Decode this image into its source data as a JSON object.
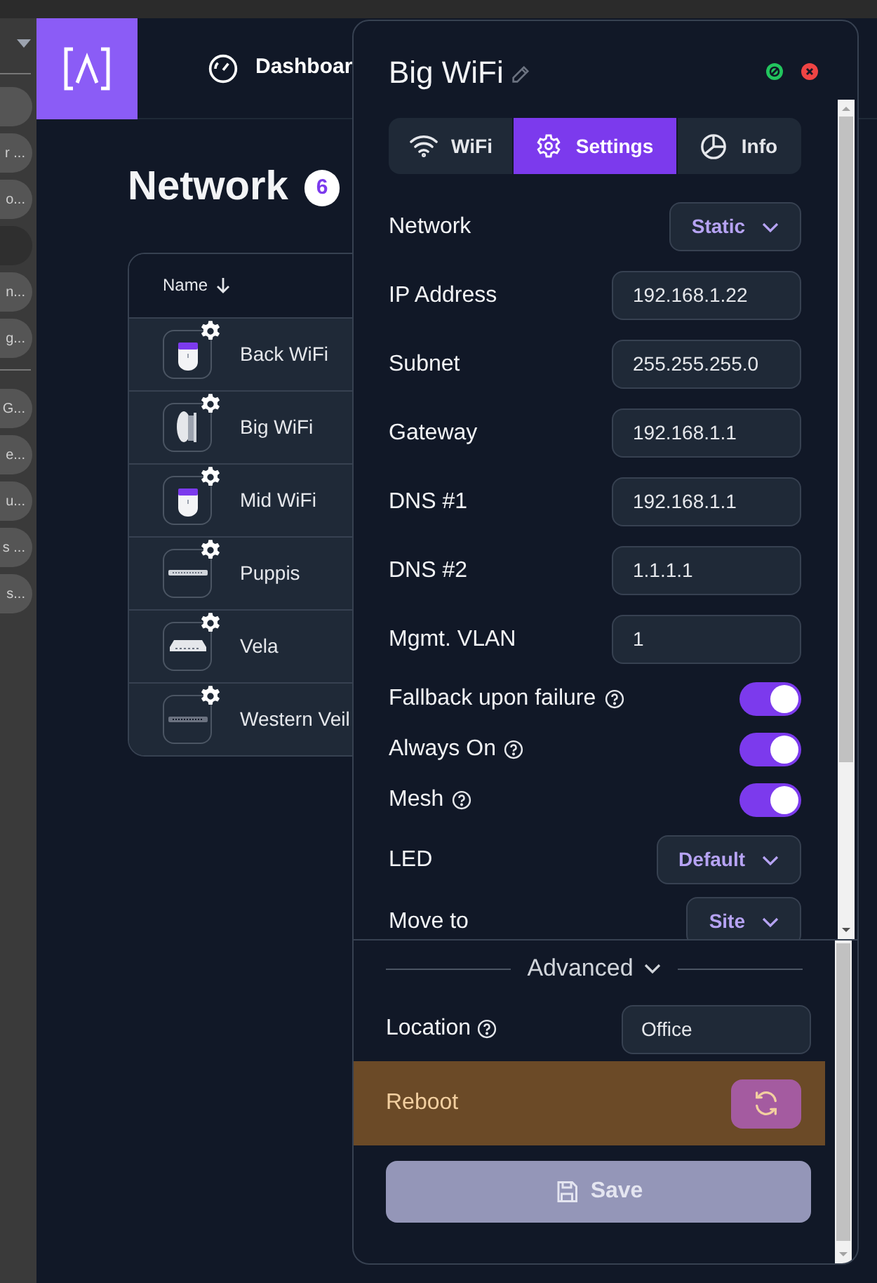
{
  "sidebar": {
    "groups": [
      [
        {
          "selected": false
        },
        {
          "label": "r ...",
          "selected": false
        },
        {
          "label": "o...",
          "selected": false
        },
        {
          "selected": true
        },
        {
          "label": "n...",
          "selected": false
        },
        {
          "label": "g...",
          "selected": false
        }
      ],
      [
        {
          "label": "G...",
          "selected": false
        },
        {
          "label": "e...",
          "selected": false
        },
        {
          "label": "u...",
          "selected": false
        },
        {
          "label": "s ...",
          "selected": false
        },
        {
          "label": "s...",
          "selected": false
        }
      ]
    ]
  },
  "nav": [
    {
      "label": "Dashboar"
    }
  ],
  "page": {
    "title": "Network",
    "count": "6"
  },
  "table": {
    "columns": [
      {
        "label": "Name"
      }
    ],
    "rows": [
      {
        "name": "Back WiFi",
        "kind": "pro-ap"
      },
      {
        "name": "Big WiFi",
        "kind": "antenna"
      },
      {
        "name": "Mid WiFi",
        "kind": "pro-ap"
      },
      {
        "name": "Puppis",
        "kind": "switch"
      },
      {
        "name": "Vela",
        "kind": "router"
      },
      {
        "name": "Western Veil",
        "kind": "dark-switch"
      }
    ]
  },
  "panel": {
    "title": "Big WiFi",
    "tabs": [
      {
        "label": "WiFi",
        "kind": "wifi",
        "selected": false
      },
      {
        "label": "Settings",
        "kind": "settings",
        "selected": true
      },
      {
        "label": "Info",
        "kind": "info",
        "selected": false
      }
    ],
    "fields": [
      {
        "kind": "select",
        "label": "Network",
        "value": "Static"
      },
      {
        "kind": "input",
        "label": "IP Address",
        "value": "192.168.1.22"
      },
      {
        "kind": "input",
        "label": "Subnet",
        "value": "255.255.255.0"
      },
      {
        "kind": "input",
        "label": "Gateway",
        "value": "192.168.1.1"
      },
      {
        "kind": "input",
        "label": "DNS #1",
        "value": "192.168.1.1"
      },
      {
        "kind": "input",
        "label": "DNS #2",
        "value": "1.1.1.1"
      },
      {
        "kind": "input",
        "label": "Mgmt. VLAN",
        "value": "1"
      },
      {
        "kind": "toggle",
        "label": "Fallback upon failure",
        "help": true,
        "on": true
      },
      {
        "kind": "toggle",
        "label": "Always On",
        "help": true,
        "on": true
      },
      {
        "kind": "toggle",
        "label": "Mesh",
        "help": true,
        "on": true
      },
      {
        "kind": "select",
        "label": "LED",
        "value": "Default"
      },
      {
        "kind": "select",
        "label": "Move to",
        "value": "Site"
      }
    ],
    "advanced": {
      "label": "Advanced"
    },
    "location": {
      "label": "Location",
      "help": true,
      "value": "Office"
    },
    "reboot": {
      "label": "Reboot"
    },
    "save": {
      "label": "Save",
      "disabled": true
    }
  }
}
